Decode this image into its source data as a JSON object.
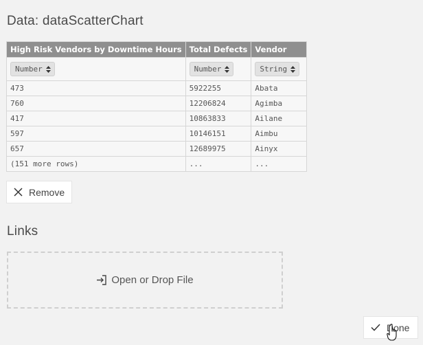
{
  "data_section": {
    "title": "Data: dataScatterChart",
    "columns": [
      {
        "header": "High Risk Vendors by Downtime Hours",
        "type": "Number"
      },
      {
        "header": "Total Defects",
        "type": "Number"
      },
      {
        "header": "Vendor",
        "type": "String"
      }
    ],
    "rows": [
      [
        "473",
        "5922255",
        "Abata"
      ],
      [
        "760",
        "12206824",
        "Agimba"
      ],
      [
        "417",
        "10863833",
        "Ailane"
      ],
      [
        "597",
        "10146151",
        "Aimbu"
      ],
      [
        "657",
        "12689975",
        "Ainyx"
      ],
      [
        "(151 more rows)",
        "...",
        "..."
      ]
    ],
    "remove_label": "Remove"
  },
  "links_section": {
    "title": "Links",
    "drop_label": "Open or Drop File"
  },
  "footer": {
    "done_label": "Done"
  },
  "icons": {
    "remove": "close-icon",
    "drop": "sign-in-icon",
    "done": "check-icon",
    "select_arrows": "sort-arrows-icon",
    "cursor": "hand-pointer-cursor"
  }
}
